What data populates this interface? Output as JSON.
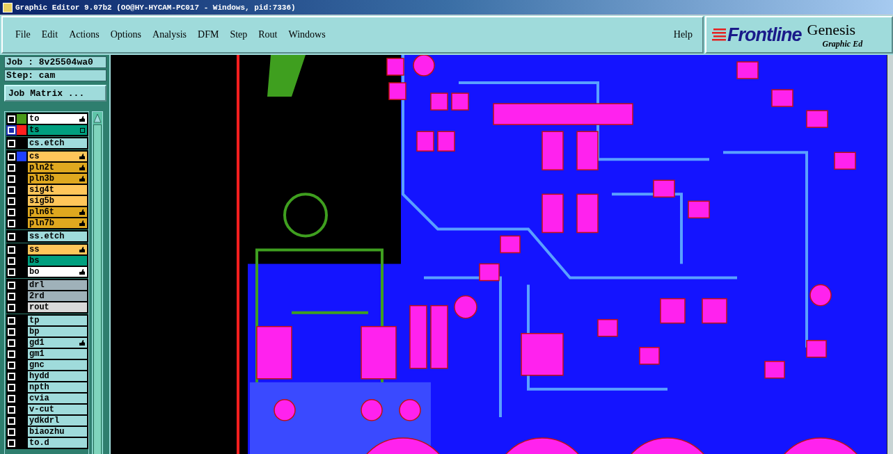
{
  "window": {
    "title": "Graphic Editor 9.07b2 (OO@HY-HYCAM-PC017 - Windows, pid:7336)"
  },
  "menu": [
    "File",
    "Edit",
    "Actions",
    "Options",
    "Analysis",
    "DFM",
    "Step",
    "Rout",
    "Windows"
  ],
  "help": "Help",
  "logo": {
    "brand": "Frontline",
    "product": "Genesis",
    "subtitle": "Graphic Ed"
  },
  "job": "Job : 8v25504wa0",
  "step": "Step: cam",
  "job_matrix_button": "Job Matrix ...",
  "layer_groups": [
    {
      "layers": [
        {
          "name": "to",
          "kind": "silk",
          "color": "#4a9a1a",
          "affected": true,
          "selected": false
        },
        {
          "name": "ts",
          "kind": "mask",
          "color": "#ff1f1f",
          "affected": false,
          "selected": true
        }
      ]
    },
    {
      "layers": [
        {
          "name": "cs.etch",
          "kind": "misc",
          "affected": false,
          "selected": false
        }
      ]
    },
    {
      "layers": [
        {
          "name": "cs",
          "kind": "signal",
          "color": "#1f3fff",
          "affected": true,
          "selected": false
        },
        {
          "name": "pln2t",
          "kind": "plane",
          "affected": true,
          "selected": false
        },
        {
          "name": "pln3b",
          "kind": "plane",
          "affected": true,
          "selected": false
        },
        {
          "name": "sig4t",
          "kind": "signal",
          "affected": false,
          "selected": false
        },
        {
          "name": "sig5b",
          "kind": "signal",
          "affected": false,
          "selected": false
        },
        {
          "name": "pln6t",
          "kind": "plane",
          "affected": true,
          "selected": false
        },
        {
          "name": "pln7b",
          "kind": "plane",
          "affected": true,
          "selected": false
        }
      ]
    },
    {
      "layers": [
        {
          "name": "ss.etch",
          "kind": "misc",
          "affected": false,
          "selected": false
        }
      ]
    },
    {
      "layers": [
        {
          "name": "ss",
          "kind": "signal",
          "affected": true,
          "selected": false
        },
        {
          "name": "bs",
          "kind": "mask",
          "affected": false,
          "selected": false
        },
        {
          "name": "bo",
          "kind": "silk",
          "affected": true,
          "selected": false
        }
      ]
    },
    {
      "layers": [
        {
          "name": "drl",
          "kind": "drill",
          "affected": false,
          "selected": false
        },
        {
          "name": "2rd",
          "kind": "drill",
          "affected": false,
          "selected": false
        },
        {
          "name": "rout",
          "kind": "rout",
          "affected": false,
          "selected": false
        }
      ]
    },
    {
      "layers": [
        {
          "name": "tp",
          "kind": "misc",
          "affected": false,
          "selected": false
        },
        {
          "name": "bp",
          "kind": "misc",
          "affected": false,
          "selected": false
        },
        {
          "name": "gd1",
          "kind": "misc",
          "affected": true,
          "selected": false
        },
        {
          "name": "gm1",
          "kind": "misc",
          "affected": false,
          "selected": false
        },
        {
          "name": "gnc",
          "kind": "misc",
          "affected": false,
          "selected": false
        },
        {
          "name": "hydd",
          "kind": "misc",
          "affected": false,
          "selected": false
        },
        {
          "name": "npth",
          "kind": "misc",
          "affected": false,
          "selected": false
        },
        {
          "name": "cvia",
          "kind": "misc",
          "affected": false,
          "selected": false
        },
        {
          "name": "v-cut",
          "kind": "misc",
          "affected": false,
          "selected": false
        },
        {
          "name": "ydkdrl",
          "kind": "misc",
          "affected": false,
          "selected": false
        },
        {
          "name": "biaozhu",
          "kind": "misc",
          "affected": false,
          "selected": false
        },
        {
          "name": "to.d",
          "kind": "misc",
          "affected": false,
          "selected": false
        }
      ]
    }
  ]
}
